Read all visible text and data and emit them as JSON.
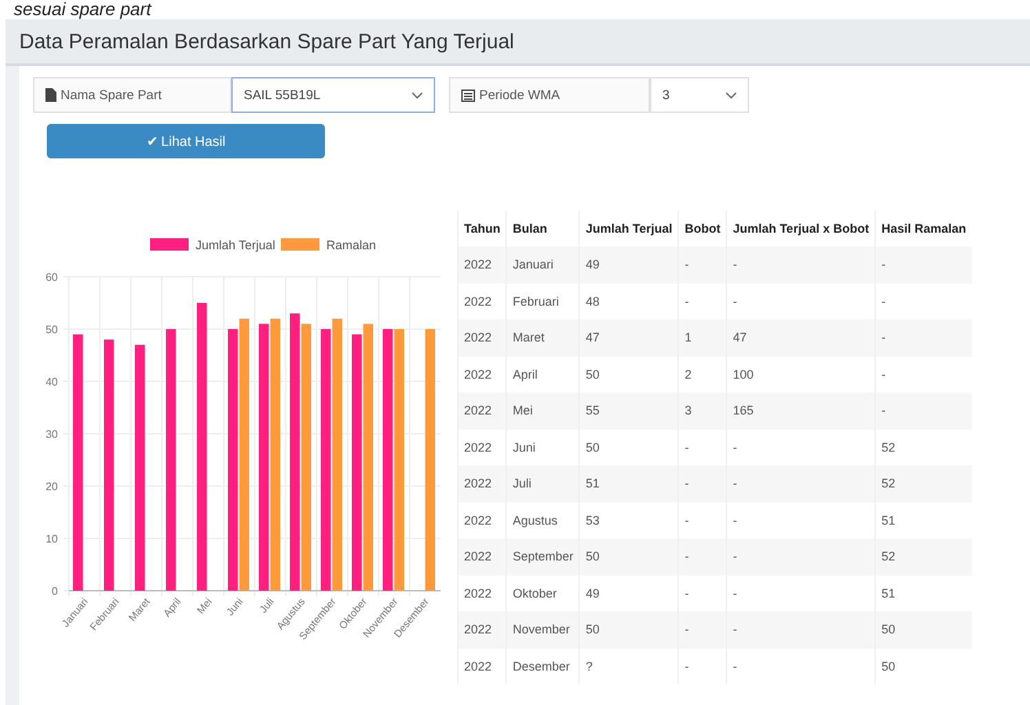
{
  "caption": "sesuai spare part",
  "card": {
    "title": "Data Peramalan Berdasarkan Spare Part Yang Terjual"
  },
  "filters": [
    {
      "label": "Nama Spare Part",
      "value": "SAIL 55B19L"
    },
    {
      "label": "Periode WMA",
      "value": "3"
    }
  ],
  "submit_button": {
    "label": "✔ Lihat Hasil"
  },
  "chart_data": {
    "type": "bar",
    "categories": [
      "Januari",
      "Februari",
      "Maret",
      "April",
      "Mei",
      "Juni",
      "Juli",
      "Agustus",
      "September",
      "Oktober",
      "November",
      "Desember"
    ],
    "series": [
      {
        "name": "Jumlah Terjual",
        "color": "#ff1f7f",
        "values": [
          49,
          48,
          47,
          50,
          55,
          50,
          51,
          53,
          50,
          49,
          50,
          null
        ]
      },
      {
        "name": "Ramalan",
        "color": "#ff9a3c",
        "values": [
          null,
          null,
          null,
          null,
          null,
          52,
          52,
          51,
          52,
          51,
          50,
          50
        ]
      }
    ],
    "ylim": [
      0,
      60
    ],
    "grid": true,
    "legend": true,
    "yticks": [
      0,
      10,
      20,
      30,
      40,
      50,
      60
    ]
  },
  "table": {
    "columns": [
      "Tahun",
      "Bulan",
      "Jumlah Terjual",
      "Bobot",
      "Jumlah Terjual x Bobot",
      "Hasil Ramalan"
    ],
    "rows": [
      [
        "2022",
        "Januari",
        "49",
        "-",
        "-",
        "-"
      ],
      [
        "2022",
        "Februari",
        "48",
        "-",
        "-",
        "-"
      ],
      [
        "2022",
        "Maret",
        "47",
        "1",
        "47",
        "-"
      ],
      [
        "2022",
        "April",
        "50",
        "2",
        "100",
        "-"
      ],
      [
        "2022",
        "Mei",
        "55",
        "3",
        "165",
        "-"
      ],
      [
        "2022",
        "Juni",
        "50",
        "-",
        "-",
        "52"
      ],
      [
        "2022",
        "Juli",
        "51",
        "-",
        "-",
        "52"
      ],
      [
        "2022",
        "Agustus",
        "53",
        "-",
        "-",
        "51"
      ],
      [
        "2022",
        "September",
        "50",
        "-",
        "-",
        "52"
      ],
      [
        "2022",
        "Oktober",
        "49",
        "-",
        "-",
        "51"
      ],
      [
        "2022",
        "November",
        "50",
        "-",
        "-",
        "50"
      ],
      [
        "2022",
        "Desember",
        "?",
        "-",
        "-",
        "50"
      ]
    ]
  }
}
